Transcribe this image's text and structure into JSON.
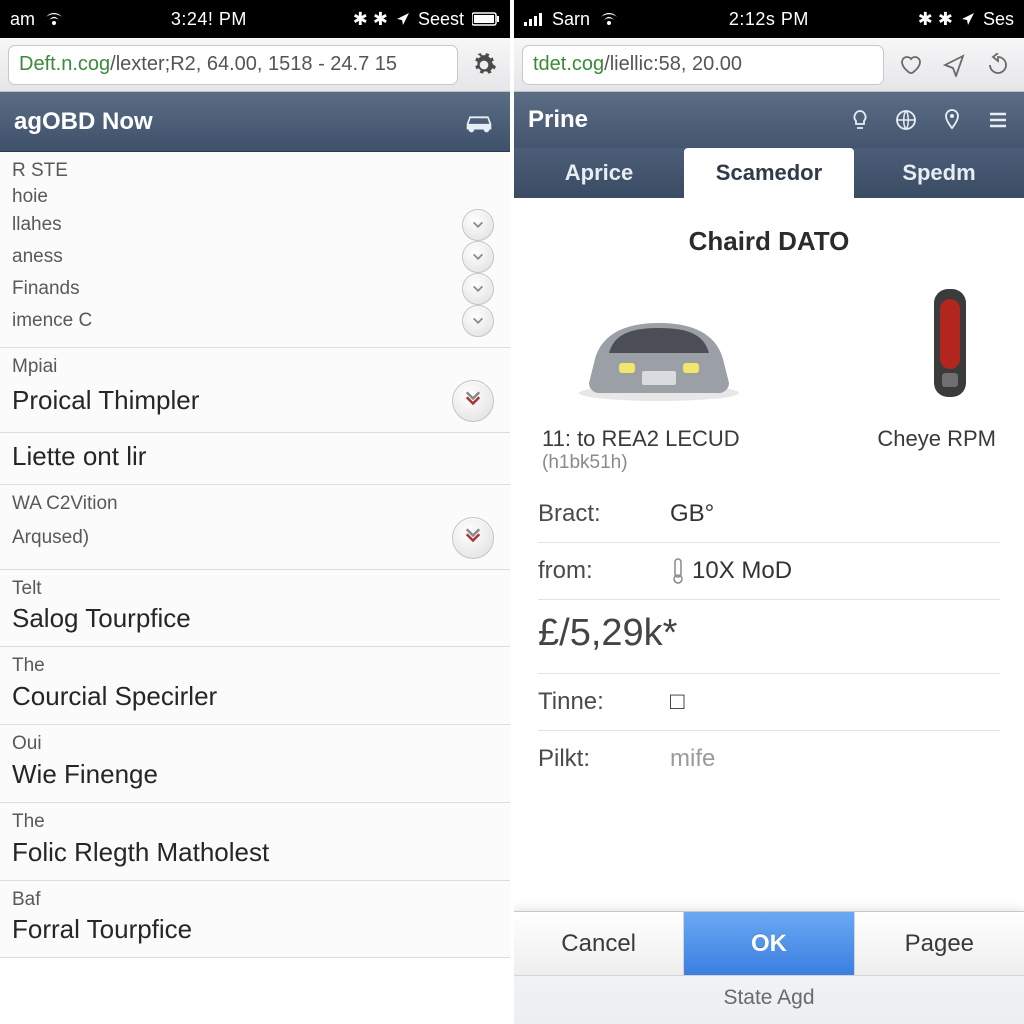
{
  "left": {
    "status": {
      "carrier": "am",
      "clock": "3:24! PM",
      "right": "Seest"
    },
    "url": {
      "host": "Deft.n.cog",
      "path": "/lexter;R2, 64.00, 1518 - 24.7 15"
    },
    "header": {
      "title": "agOBD Now"
    },
    "groups": [
      {
        "lines": [
          {
            "text": "R STE",
            "cls": "small"
          },
          {
            "text": "hoie",
            "cls": "small"
          },
          {
            "text": "llahes",
            "cls": "small",
            "chev": true
          },
          {
            "text": "aness",
            "cls": "small",
            "chev": true
          },
          {
            "text": "Finands",
            "cls": "small",
            "chev": true
          },
          {
            "text": "imence C",
            "cls": "small",
            "chev": true
          }
        ]
      },
      {
        "lines": [
          {
            "text": "Mpiai",
            "cls": "small"
          },
          {
            "text": "Proical Thimpler",
            "cls": "big",
            "chev": true,
            "bigchev": true
          }
        ]
      },
      {
        "lines": [
          {
            "text": "Liette ont lir",
            "cls": "big"
          }
        ]
      },
      {
        "lines": [
          {
            "text": "WA C2Vition",
            "cls": "small"
          },
          {
            "text": "Arqused)",
            "cls": "small",
            "chev": true,
            "bigchev": true
          }
        ]
      },
      {
        "lines": [
          {
            "text": "Telt",
            "cls": "small"
          },
          {
            "text": "Salog Tourpfice",
            "cls": "big"
          }
        ]
      },
      {
        "lines": [
          {
            "text": "The",
            "cls": "small"
          },
          {
            "text": "Courcial Specirler",
            "cls": "big"
          }
        ]
      },
      {
        "lines": [
          {
            "text": "Oui",
            "cls": "small"
          },
          {
            "text": "Wie Finenge",
            "cls": "big"
          }
        ]
      },
      {
        "lines": [
          {
            "text": "The",
            "cls": "small"
          },
          {
            "text": "Folic Rlegth Matholest",
            "cls": "big"
          }
        ]
      },
      {
        "lines": [
          {
            "text": "Baf",
            "cls": "small"
          },
          {
            "text": "Forral Tourpfice",
            "cls": "big"
          }
        ]
      }
    ]
  },
  "right": {
    "status": {
      "carrier": "Sarn",
      "clock": "2:12s PM",
      "right": "Ses"
    },
    "url": {
      "host": "tdet.cog",
      "path": "/liellic:58, 20.00"
    },
    "header": {
      "title": "Prine"
    },
    "tabs": [
      {
        "label": "Aprice",
        "active": false
      },
      {
        "label": "Scamedor",
        "active": true
      },
      {
        "label": "Spedm",
        "active": false
      }
    ],
    "panel": {
      "title": "Chaird DATO",
      "car": {
        "label": "11: to REA2 LECUD",
        "sub": "(h1bk51h)"
      },
      "rpm": "Cheye RPM",
      "rows": {
        "bract_k": "Bract:",
        "bract_v": "GB°",
        "from_k": "from:",
        "from_v": "10X MoD",
        "price": "£/5,29k*",
        "time_k": "Tinne:",
        "time_v": "□",
        "pilk_k": "Pilkt:",
        "pilk_v": "mife"
      }
    },
    "sheet": {
      "cancel": "Cancel",
      "ok": "OK",
      "page": "Pagee",
      "label": "State Agd"
    }
  }
}
